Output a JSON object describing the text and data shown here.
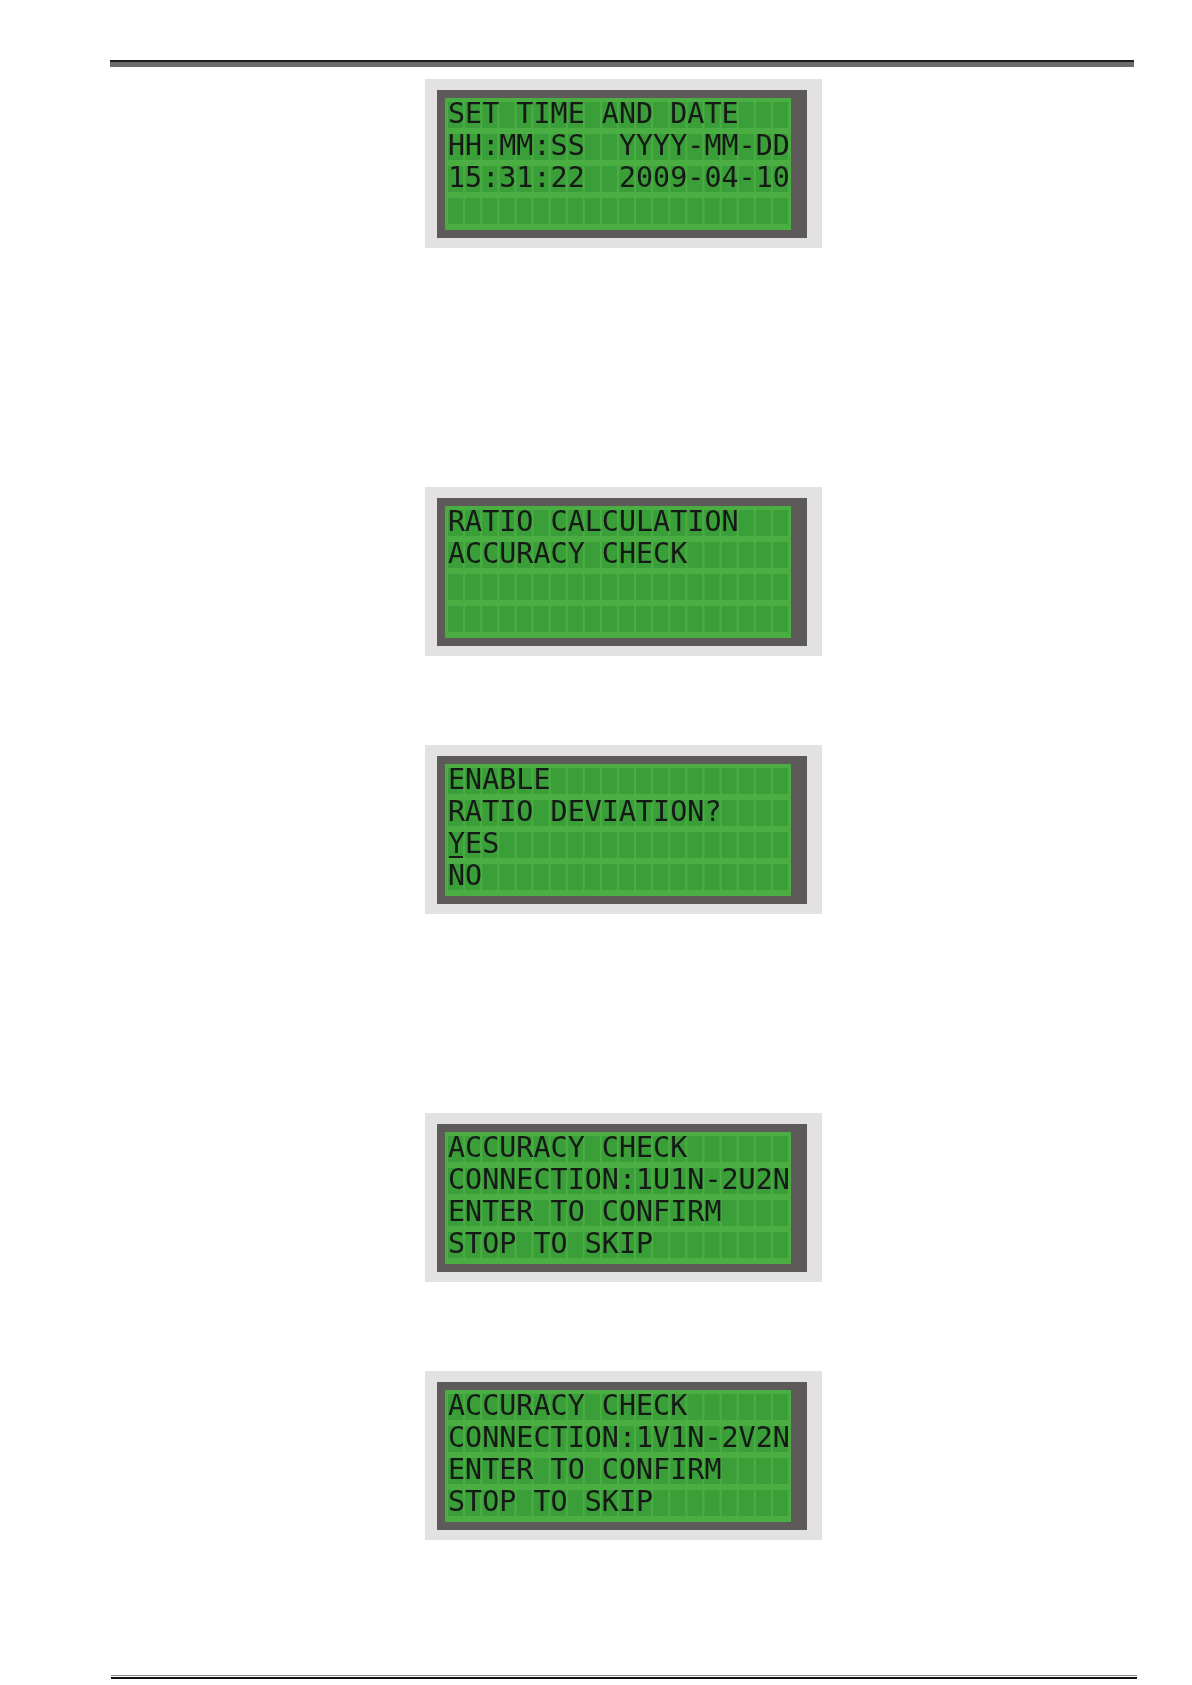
{
  "screens": [
    {
      "lines": [
        "SET TIME AND DATE",
        "HH:MM:SS  YYYY-MM-DD",
        "15:31:22  2009-04-10"
      ]
    },
    {
      "lines": [
        "RATIO CALCULATION",
        "ACCURACY CHECK"
      ]
    },
    {
      "lines": [
        "ENABLE",
        "RATIO DEVIATION?"
      ],
      "options": [
        {
          "label": "YES",
          "selected": true
        },
        {
          "label": "NO",
          "selected": false
        }
      ]
    },
    {
      "lines": [
        "ACCURACY CHECK",
        "CONNECTION:1U1N-2U2N",
        "ENTER TO CONFIRM",
        "STOP TO SKIP"
      ]
    },
    {
      "lines": [
        "ACCURACY CHECK",
        "CONNECTION:1V1N-2V2N",
        "ENTER TO CONFIRM",
        "STOP TO SKIP"
      ]
    }
  ]
}
